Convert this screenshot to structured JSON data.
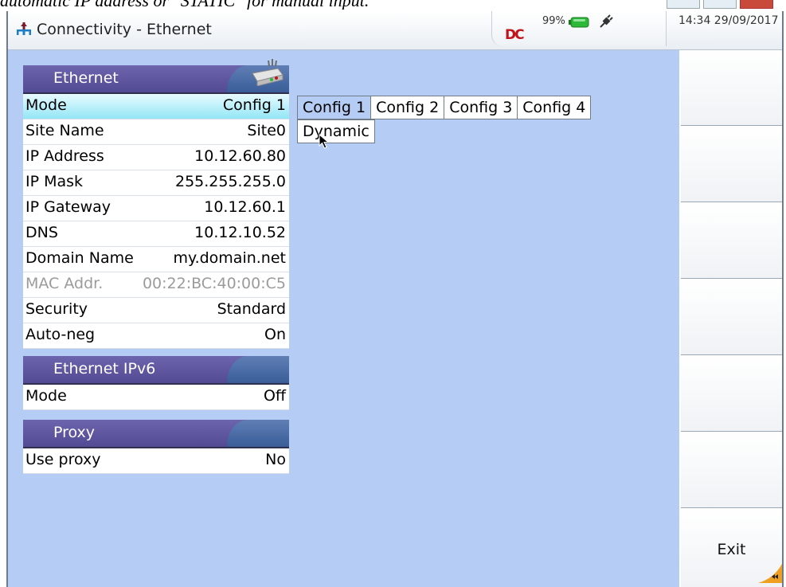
{
  "caption": "automatic IP address or \"STATIC\" for manual input.",
  "titlebar": {
    "title": "Connectivity - Ethernet",
    "logo_text": "DC",
    "battery_percent": "99%",
    "datetime": "14:34 29/09/2017"
  },
  "panels": {
    "ethernet": {
      "header": "Ethernet",
      "rows": [
        {
          "key": "Mode",
          "value": "Config 1"
        },
        {
          "key": "Site Name",
          "value": "Site0"
        },
        {
          "key": "IP Address",
          "value": "10.12.60.80"
        },
        {
          "key": "IP Mask",
          "value": "255.255.255.0"
        },
        {
          "key": "IP Gateway",
          "value": "10.12.60.1"
        },
        {
          "key": "DNS",
          "value": "10.12.10.52"
        },
        {
          "key": "Domain Name",
          "value": "my.domain.net"
        },
        {
          "key": "MAC Addr.",
          "value": "00:22:BC:40:00:C5"
        },
        {
          "key": "Security",
          "value": "Standard"
        },
        {
          "key": "Auto-neg",
          "value": "On"
        }
      ]
    },
    "ipv6": {
      "header": "Ethernet IPv6",
      "rows": [
        {
          "key": "Mode",
          "value": "Off"
        }
      ]
    },
    "proxy": {
      "header": "Proxy",
      "rows": [
        {
          "key": "Use proxy",
          "value": "No"
        }
      ]
    }
  },
  "mode_options": [
    "Config 1",
    "Config 2",
    "Config 3",
    "Config 4"
  ],
  "selected_option": "Config 1",
  "extra_option": "Dynamic",
  "softkeys": [
    "",
    "",
    "",
    "",
    "",
    "",
    "Exit"
  ],
  "colors": {
    "background": "#b5ccf5",
    "panel_header": "#5a529c",
    "selected_row": "#93e6f5",
    "logo_red": "#c0141b"
  }
}
